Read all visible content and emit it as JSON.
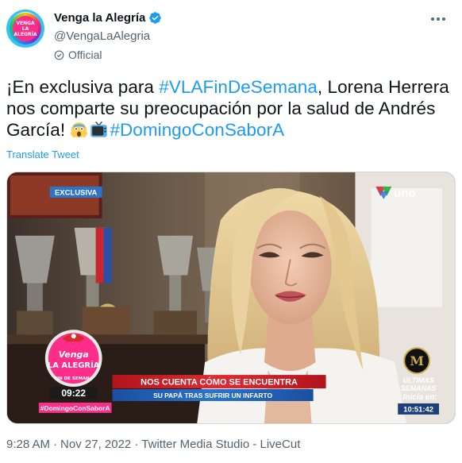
{
  "account": {
    "display_name": "Venga la Alegría",
    "handle": "@VengaLaAlegria",
    "label": "Official",
    "avatar_text_1": "VENGA",
    "avatar_text_2": "LA ALEGRÍA"
  },
  "tweet": {
    "text_1": "¡En exclusiva para ",
    "hashtag_1": "#VLAFinDeSemana",
    "text_2": ", Lorena Herrera nos comparte su preocupación por la salud de Andrés García! ",
    "hashtag_2": "#DomingoConSaborA",
    "translate_label": "Translate Tweet"
  },
  "video_overlay": {
    "badge": "EXCLUSIVA",
    "channel": "uno",
    "show_logo_1": "Venga",
    "show_logo_2": "LA ALEGRÍA",
    "show_logo_sub": "FIN DE SEMANA",
    "show_time": "09:22",
    "show_hashtag": "#DomingoConSaborA",
    "lower_third_top": "NOS CUENTA CÓMO SE ENCUENTRA",
    "lower_third_bottom": "SU PAPÁ TRAS SUFRIR UN INFARTO",
    "next_line_1": "ÚLTIMAS",
    "next_line_2": "SEMANAS",
    "next_line_3": "Inicia en:",
    "next_countdown": "10:51:42"
  },
  "meta": {
    "time": "9:28 AM",
    "date": "Nov 27, 2022",
    "source": "Twitter Media Studio - LiveCut",
    "separator": "·"
  },
  "colors": {
    "accent": "#1d9bf0",
    "text": "#0f1419",
    "secondary": "#536471",
    "lower_third_red": "#d8202a",
    "lower_third_blue": "#1f5fb5"
  }
}
